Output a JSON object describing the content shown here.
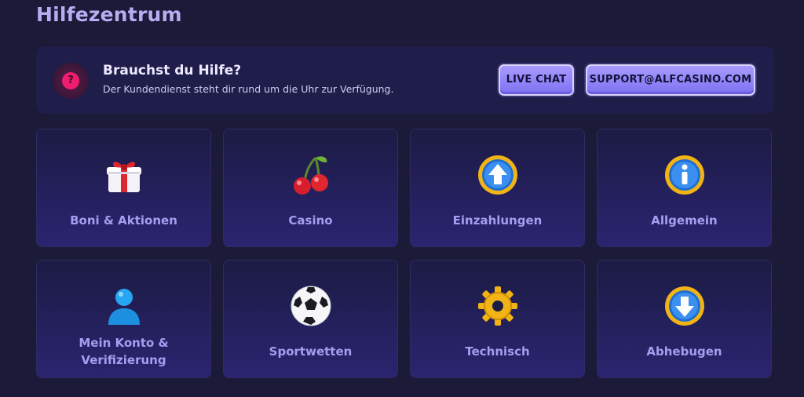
{
  "page": {
    "title": "Hilfezentrum"
  },
  "help": {
    "title": "Brauchst du Hilfe?",
    "subtitle": "Der Kundendienst steht dir rund um die Uhr zur Verfügung.",
    "badge": "?",
    "live_chat_label": "LIVE CHAT",
    "email_label": "SUPPORT@ALFCASINO.COM"
  },
  "categories": [
    {
      "label": "Boni & Aktionen",
      "icon": "gift-icon"
    },
    {
      "label": "Casino",
      "icon": "cherries-icon"
    },
    {
      "label": "Einzahlungen",
      "icon": "arrow-up-coin-icon"
    },
    {
      "label": "Allgemein",
      "icon": "info-coin-icon"
    },
    {
      "label": "Mein Konto &",
      "label2": "Verifizierung",
      "icon": "user-icon"
    },
    {
      "label": "Sportwetten",
      "icon": "soccer-ball-icon"
    },
    {
      "label": "Technisch",
      "icon": "gear-icon"
    },
    {
      "label": "Abhebugen",
      "icon": "arrow-down-coin-icon"
    }
  ],
  "colors": {
    "background": "#1b1a38",
    "accent": "#a79bff",
    "help_badge": "#f01c6e"
  }
}
